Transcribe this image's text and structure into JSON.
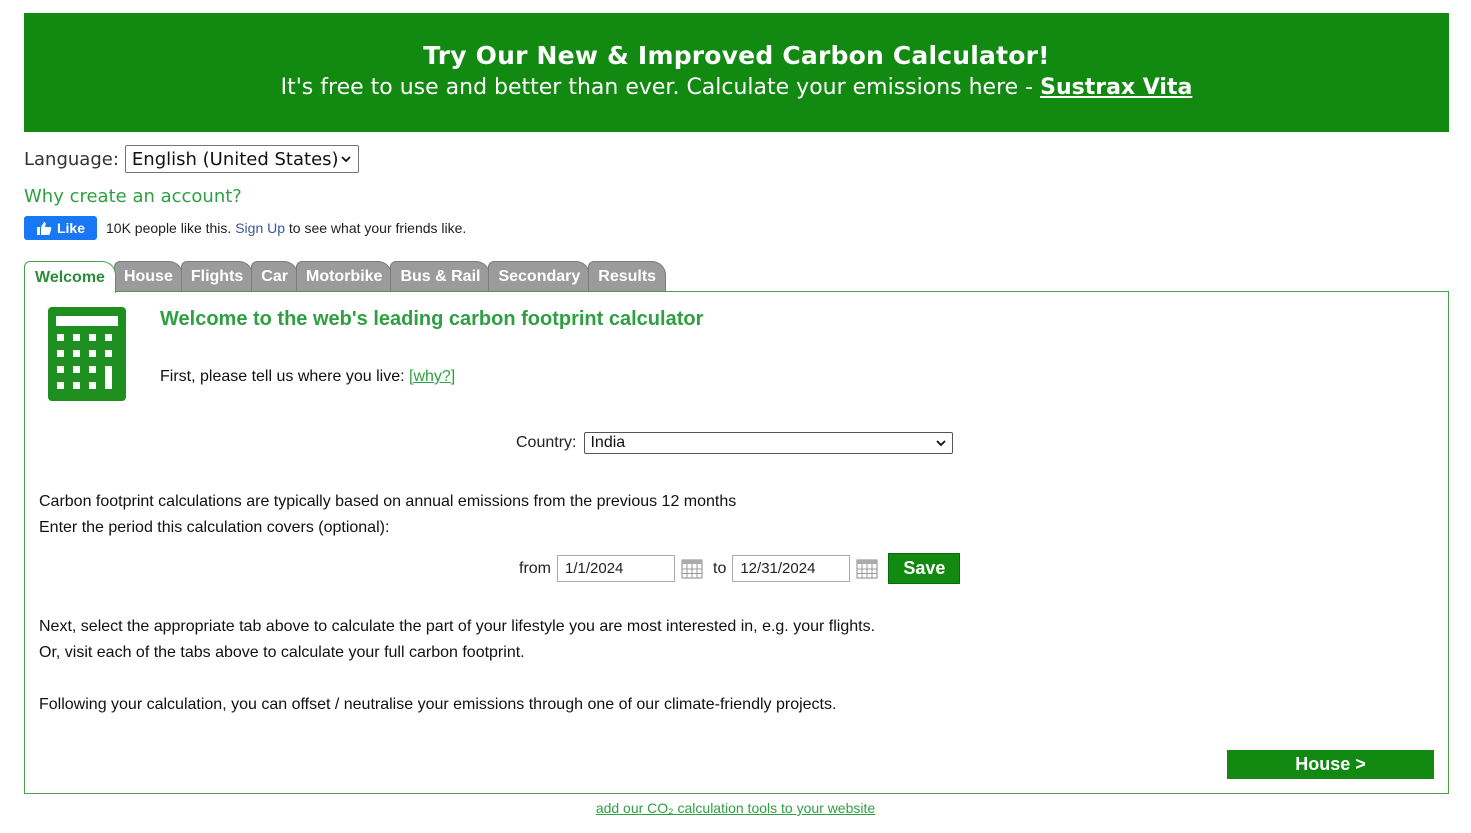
{
  "banner": {
    "title": "Try Our New & Improved Carbon Calculator!",
    "subtitle": "It's free to use and better than ever. Calculate your emissions here - ",
    "link": "Sustrax Vita"
  },
  "language": {
    "label": "Language:",
    "selected": "English (United States)"
  },
  "why_account": "Why create an account?",
  "facebook": {
    "like_label": "Like",
    "count_text": "10K people like this.",
    "signup": "Sign Up",
    "suffix": "to see what your friends like."
  },
  "tabs": [
    {
      "label": "Welcome",
      "active": true
    },
    {
      "label": "House"
    },
    {
      "label": "Flights"
    },
    {
      "label": "Car"
    },
    {
      "label": "Motorbike"
    },
    {
      "label": "Bus & Rail"
    },
    {
      "label": "Secondary"
    },
    {
      "label": "Results"
    }
  ],
  "welcome": {
    "headline": "Welcome to the web's leading carbon footprint calculator",
    "intro": "First, please tell us where you live: ",
    "why_link": "[why?]",
    "country_label": "Country:",
    "country_selected": "India",
    "line1": "Carbon footprint calculations are typically based on annual emissions from the previous 12 months",
    "line2": "Enter the period this calculation covers (optional):",
    "from_label": "from",
    "from_value": "1/1/2024",
    "to_label": "to",
    "to_value": "12/31/2024",
    "save": "Save",
    "next1": "Next, select the appropriate tab above to calculate the part of your lifestyle you are most interested in, e.g. your flights.",
    "next2": "Or, visit each of the tabs above to calculate your full carbon footprint.",
    "offset": "Following your calculation, you can offset / neutralise your emissions through one of our climate-friendly projects.",
    "next_button": "House >"
  },
  "footer": {
    "link": "add our CO₂ calculation tools to your website"
  },
  "colors": {
    "brand_green": "#128a12",
    "link_green": "#2ea043",
    "tab_gray": "#9b9b9b",
    "fb_blue": "#1877f2"
  }
}
